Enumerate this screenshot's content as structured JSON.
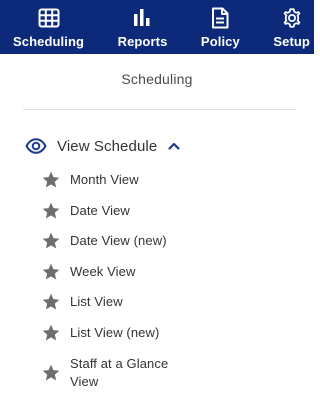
{
  "nav": {
    "items": [
      {
        "label": "Scheduling",
        "icon": "calendar-grid-icon"
      },
      {
        "label": "Reports",
        "icon": "bar-chart-icon"
      },
      {
        "label": "Policy",
        "icon": "document-icon"
      },
      {
        "label": "Setup",
        "icon": "gear-icon"
      }
    ],
    "background": "#0d2a7a"
  },
  "page": {
    "title": "Scheduling"
  },
  "section": {
    "label": "View Schedule",
    "icon": "eye-icon",
    "toggle_icon": "chevron-up-icon",
    "accent": "#1d3a8f",
    "items": [
      {
        "label": "Month View",
        "icon": "star-icon"
      },
      {
        "label": "Date View",
        "icon": "star-icon"
      },
      {
        "label": "Date View (new)",
        "icon": "star-icon"
      },
      {
        "label": "Week View",
        "icon": "star-icon"
      },
      {
        "label": "List View",
        "icon": "star-icon"
      },
      {
        "label": "List View (new)",
        "icon": "star-icon"
      },
      {
        "label": "Staff at a Glance View",
        "icon": "star-icon"
      }
    ]
  }
}
